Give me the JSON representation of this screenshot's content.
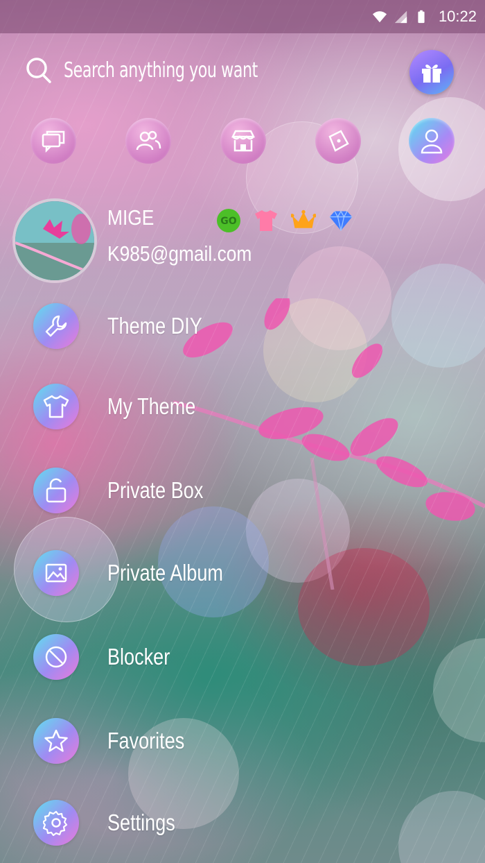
{
  "status_bar": {
    "time": "10:22",
    "icons": [
      "wifi-icon",
      "signal-icon",
      "battery-icon"
    ]
  },
  "search": {
    "placeholder": "Search anything you want",
    "icon": "search-icon"
  },
  "gift": {
    "icon": "gift-icon"
  },
  "quick_actions": [
    {
      "icon": "chat-icon"
    },
    {
      "icon": "contacts-icon"
    },
    {
      "icon": "store-icon"
    },
    {
      "icon": "discover-icon"
    },
    {
      "icon": "profile-icon",
      "active": true
    }
  ],
  "profile": {
    "name": "MIGE",
    "email": "K985@gmail.com",
    "badges": [
      "go-badge-icon",
      "shirt-badge-icon",
      "crown-badge-icon",
      "diamond-badge-icon"
    ]
  },
  "menu": [
    {
      "label": "Theme DIY",
      "icon": "wrench-icon"
    },
    {
      "label": "My Theme",
      "icon": "tshirt-icon"
    },
    {
      "label": "Private Box",
      "icon": "unlock-icon"
    },
    {
      "label": "Private Album",
      "icon": "image-icon"
    },
    {
      "label": "Blocker",
      "icon": "block-icon"
    },
    {
      "label": "Favorites",
      "icon": "star-icon"
    },
    {
      "label": "Settings",
      "icon": "gear-icon"
    }
  ],
  "colors": {
    "accent_gradient": [
      "#5fe0ef",
      "#9f8bf2",
      "#ec7ad9"
    ],
    "quick_button": "#d17fc4",
    "gift_gradient": [
      "#b38bff",
      "#5fb6f5"
    ]
  }
}
